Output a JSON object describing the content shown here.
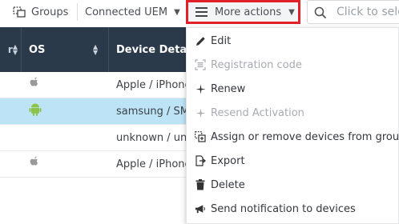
{
  "toolbar": {
    "groups_label": "Groups",
    "uem_label": "Connected UEM",
    "more_actions_label": "More actions",
    "search_placeholder": "Click to sele"
  },
  "table": {
    "headers": {
      "os": "OS",
      "device_details": "Device Details"
    },
    "rows": [
      {
        "os_icon": "apple-icon",
        "detail": "Apple / iPhone",
        "selected": false
      },
      {
        "os_icon": "android-icon",
        "detail": "samsung / SM-",
        "selected": true
      },
      {
        "os_icon": "",
        "detail": "unknown / unk",
        "selected": false
      },
      {
        "os_icon": "apple-icon",
        "detail": "Apple / iPhone",
        "selected": false
      }
    ]
  },
  "menu": {
    "items": [
      {
        "label": "Edit",
        "icon": "pencil-icon",
        "disabled": false
      },
      {
        "label": "Registration code",
        "icon": "barcode-icon",
        "disabled": true
      },
      {
        "label": "Renew",
        "icon": "sparkle-icon",
        "disabled": false
      },
      {
        "label": "Resend Activation",
        "icon": "sparkle-icon",
        "disabled": true
      },
      {
        "label": "Assign or remove devices from group",
        "icon": "group-assign-icon",
        "disabled": false
      },
      {
        "label": "Export",
        "icon": "export-icon",
        "disabled": false
      },
      {
        "label": "Delete",
        "icon": "trash-icon",
        "disabled": false
      },
      {
        "label": "Send notification to devices",
        "icon": "megaphone-icon",
        "disabled": false
      }
    ]
  },
  "colors": {
    "header_bg": "#2b3a4b",
    "selected_row": "#bde3f6",
    "highlight_border": "#e2202a",
    "android_green": "#8bc34a",
    "apple_gray": "#9a9a9a"
  }
}
